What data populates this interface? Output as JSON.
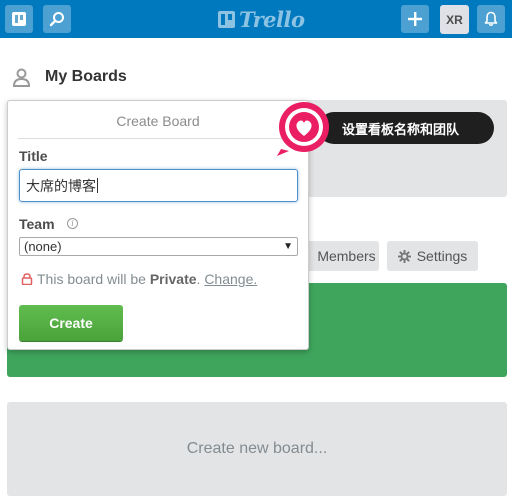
{
  "topbar": {
    "logo_text": "Trello",
    "avatar_initials": "XR",
    "icons": [
      "boards-icon",
      "search-icon",
      "plus-icon",
      "bell-icon"
    ]
  },
  "section": {
    "title": "My Boards"
  },
  "popover": {
    "title": "Create Board",
    "title_label": "Title",
    "title_value": "大席的博客",
    "team_label": "Team",
    "team_value": "(none)",
    "privacy_prefix": "This board will be ",
    "privacy_level": "Private",
    "privacy_sep": ". ",
    "privacy_change": "Change.",
    "create_label": "Create"
  },
  "board_buttons": {
    "members": "Members",
    "settings": "Settings"
  },
  "create_new_tile": "Create new board...",
  "callout": {
    "text": "设置看板名称和团队"
  },
  "colors": {
    "topbar": "#0079bf",
    "green": "#3fa55d",
    "create": "#5aac44",
    "badge": "#e91e63"
  }
}
